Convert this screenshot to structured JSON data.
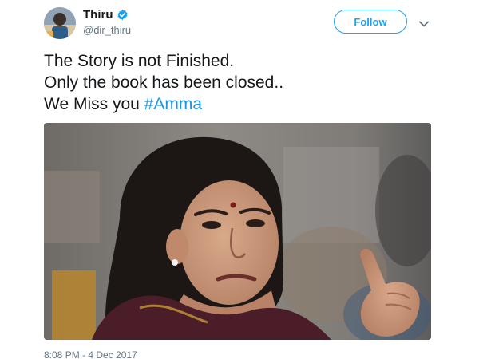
{
  "author": {
    "display_name": "Thiru",
    "handle": "@dir_thiru",
    "verified": true
  },
  "actions": {
    "follow_label": "Follow"
  },
  "tweet": {
    "line1": "The Story is not Finished.",
    "line2": "Only the book has been closed..",
    "line3_prefix": "We Miss you ",
    "hashtag": "#Amma"
  },
  "timestamp": "8:08 PM - 4 Dec 2017",
  "colors": {
    "accent": "#1da1f2",
    "hashtag": "#1b95e0",
    "text": "#14171a",
    "secondary_text": "#657786"
  },
  "icons": [
    "verified-badge-icon",
    "chevron-down-icon"
  ]
}
